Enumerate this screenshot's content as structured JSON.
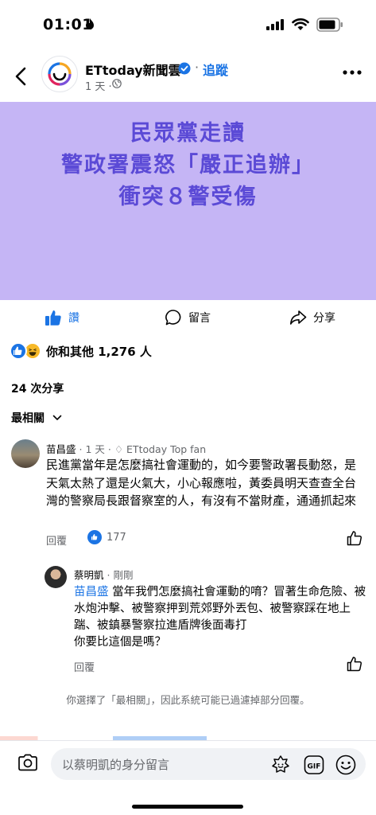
{
  "status_bar": {
    "time": "01:01"
  },
  "post": {
    "page_name": "ETtoday新聞雲",
    "follow_label": "追蹤",
    "time": "1 天",
    "headline": [
      "民眾黨走讀",
      "警政署震怒「嚴正追辦」",
      "衝突８警受傷"
    ],
    "headline_bg": "#c5b5f5",
    "headline_color": "#5b4ad6"
  },
  "actions": {
    "like": "讚",
    "comment": "留言",
    "share": "分享"
  },
  "reactions": {
    "text": "你和其他 1,276 人"
  },
  "shares": "24 次分享",
  "sort": {
    "label": "最相關"
  },
  "comments": [
    {
      "author": "苗昌盛",
      "time": "1 天",
      "badge": "ETtoday Top fan",
      "body": "民進黨當年是怎麼搞社會運動的，如今要警政署長動怒，是天氣太熱了還是火氣大，小心報應啦，黃委員明天查查全台灣的警察局長跟督察室的人，有沒有不當財產，通通抓起來",
      "reply": "回覆",
      "likes": "177"
    },
    {
      "author": "蔡明凱",
      "time": "剛剛",
      "mention": "苗昌盛",
      "body": " 當年我們怎麼搞社會運動的唷？冒著生命危險、被水炮沖擊、被警察押到荒郊野外丟包、被警察踩在地上踹、被鎮暴警察拉進盾牌後面毒打",
      "body2": "你要比這個是嗎？",
      "reply": "回覆"
    }
  ],
  "filter_note": "你選擇了「最相關」，因此系統可能已過濾掉部分回覆。",
  "composer": {
    "placeholder": "以蔡明凱的身分留言"
  },
  "colors": {
    "accent": "#1b74e4",
    "muted": "#65676b"
  }
}
